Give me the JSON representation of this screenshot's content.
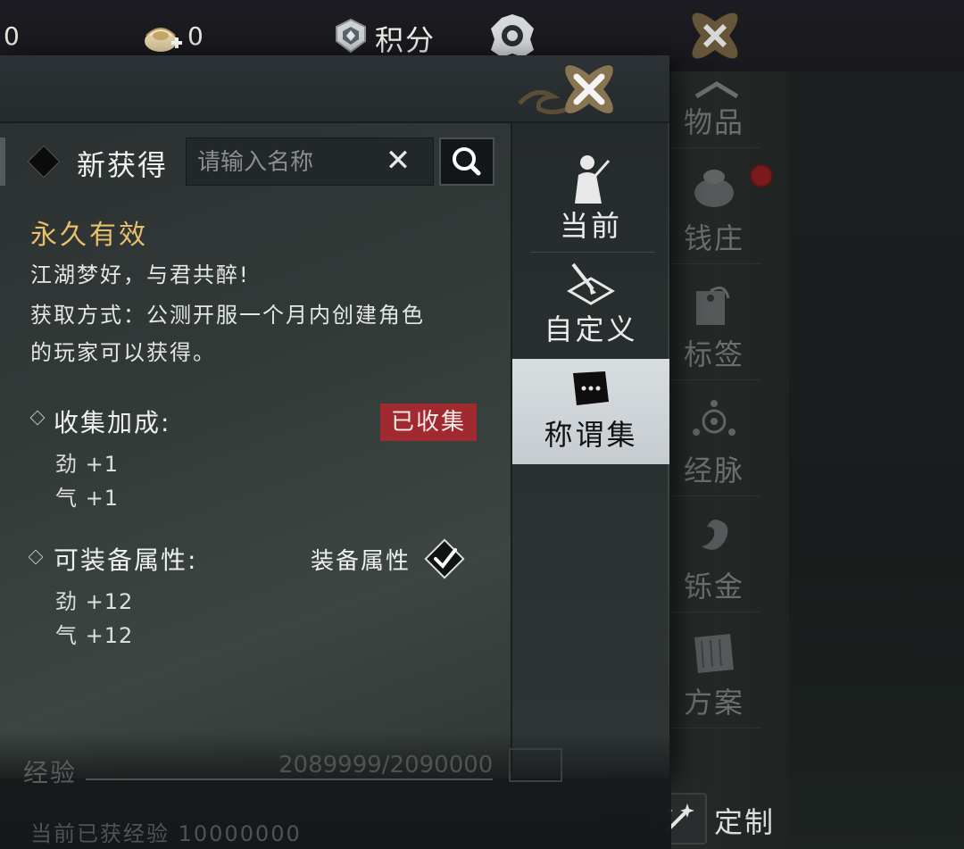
{
  "currency": {
    "first_value": "0",
    "ingot_value": "0",
    "score_label": "积分"
  },
  "right_menu": {
    "items": [
      {
        "label": "物品",
        "icon": "up-arrow-icon"
      },
      {
        "label": "钱庄",
        "icon": "money-bag-icon"
      },
      {
        "label": "标签",
        "icon": "tag-icon"
      },
      {
        "label": "经脉",
        "icon": "meridian-icon"
      },
      {
        "label": "铄金",
        "icon": "swirl-icon"
      },
      {
        "label": "方案",
        "icon": "scroll-icon"
      }
    ],
    "custom_label": "定制"
  },
  "tabs": [
    {
      "label": "当前",
      "icon": "character-icon",
      "active": false
    },
    {
      "label": "自定义",
      "icon": "brush-icon",
      "active": false
    },
    {
      "label": "称谓集",
      "icon": "speech-scroll-icon",
      "active": true
    }
  ],
  "filter": {
    "label": "新获得",
    "search_placeholder": "请输入名称",
    "clear_symbol": "✕"
  },
  "detail": {
    "validity": "永久有效",
    "motto": "江湖梦好，与君共醉!",
    "acquire_line1": "获取方式：公测开服一个月内创建角色",
    "acquire_line2": "的玩家可以获得。",
    "collection": {
      "title": "收集加成:",
      "badge": "已收集",
      "stats": [
        "劲 +1",
        "气 +1"
      ]
    },
    "equip": {
      "title": "可装备属性:",
      "toggle_label": "装备属性",
      "checked": true,
      "stats": [
        "劲 +12",
        "气 +12"
      ]
    }
  },
  "footer": {
    "exp_label": "经验",
    "exp_value": "2089999/2090000",
    "sub_text": "当前已获经验  10000000"
  },
  "colors": {
    "gold_text": "#e8bf6a",
    "badge_red": "#a02a2f",
    "active_tab": "#d8dde0"
  }
}
